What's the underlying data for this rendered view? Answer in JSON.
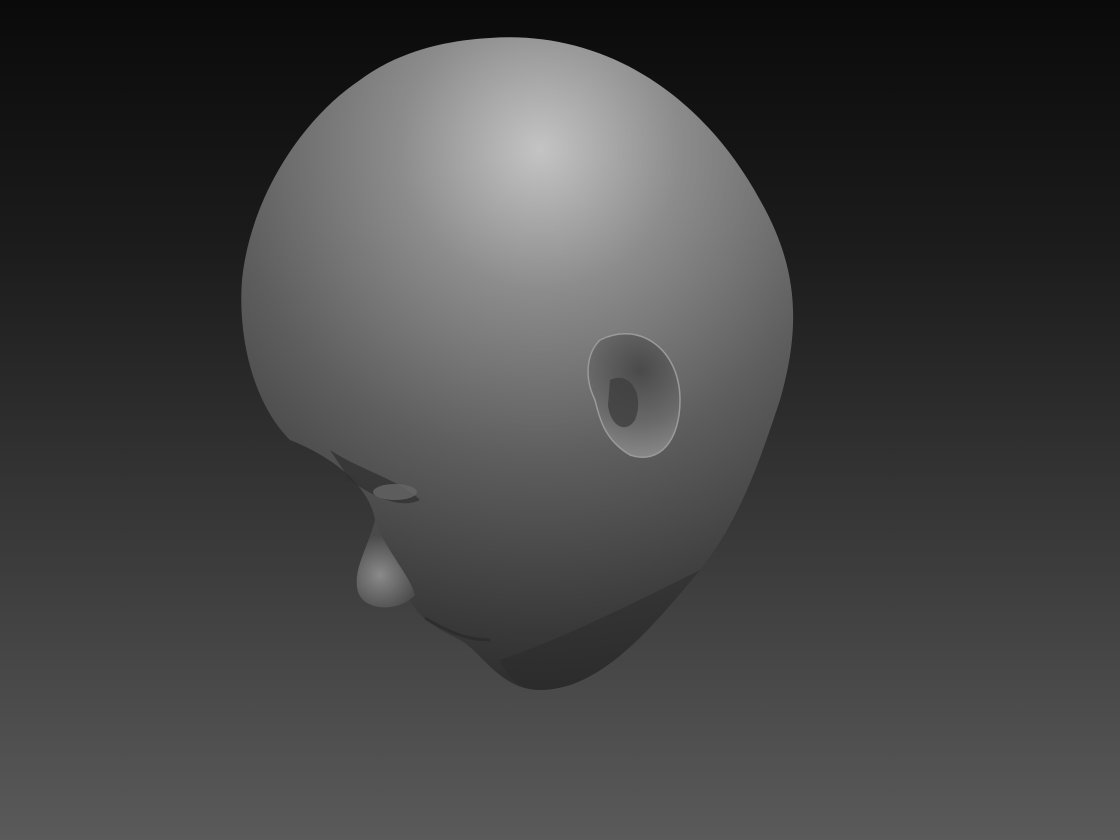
{
  "scene": {
    "subject": "sculpted-head",
    "colors": {
      "background_top": "#0a0a0a",
      "background_bottom": "#5a5a5a",
      "material_highlight": "#c4c4c4",
      "material_mid": "#6e6e6e",
      "material_shadow": "#2e2e2e"
    }
  }
}
